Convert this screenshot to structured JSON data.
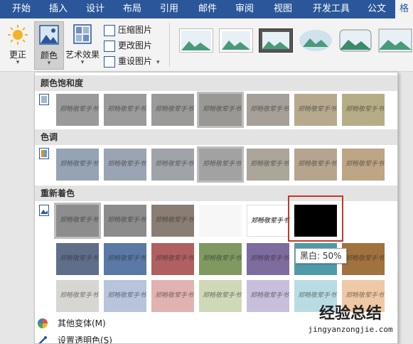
{
  "tabs": [
    "开始",
    "插入",
    "设计",
    "布局",
    "引用",
    "邮件",
    "审阅",
    "视图",
    "开发工具",
    "公文",
    "格"
  ],
  "ribbon": {
    "correct_label": "更正",
    "color_label": "颜色",
    "artistic_label": "艺术效果",
    "compress_label": "压缩图片",
    "change_label": "更改图片",
    "reset_label": "重设图片"
  },
  "panel": {
    "saturation_header": "颜色饱和度",
    "tone_header": "色调",
    "recolor_header": "重新着色",
    "swatch_text": "郑畅敬荤手书",
    "tooltip": "黑白: 50%",
    "more_variants": "其他变体(M)",
    "set_transparent": "设置透明色(S)"
  },
  "colors": {
    "saturation": [
      "#9a9a9a",
      "#9b9b9b",
      "#9a9a98",
      "#999894",
      "#a6a098",
      "#b6a98e",
      "#b5ad86"
    ],
    "tone": [
      "#95a3b5",
      "#9aa4b2",
      "#a0a4a9",
      "#a2a2a2",
      "#aba59a",
      "#b6a48e",
      "#bda586"
    ],
    "recolor_row1": [
      "#8d8d8d",
      "#8c8c8c",
      "#8a7e74",
      "#f7f7f7",
      "#ffffff",
      "#000000"
    ],
    "recolor_row2": [
      "#5f6f8a",
      "#5b79a6",
      "#b06060",
      "#7f9960",
      "#7d6c9e",
      "#4f9aa9",
      "#a0723e"
    ],
    "recolor_row3": [
      "#d7d6d3",
      "#b7c4dc",
      "#e1b3b0",
      "#cfd8b7",
      "#c7bfdc",
      "#b9dce2",
      "#efc9a6"
    ],
    "accent": "#2b579a",
    "highlight": "#c0392b"
  },
  "watermark": {
    "main": "经验总结",
    "sub": "jingyanzongjie.com"
  }
}
